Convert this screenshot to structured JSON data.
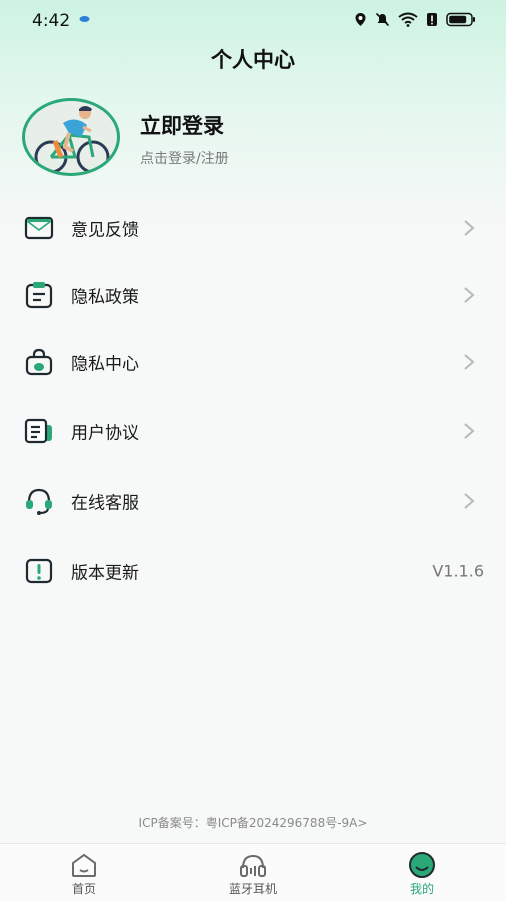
{
  "status_bar": {
    "time": "4:42"
  },
  "header": {
    "title": "个人中心"
  },
  "profile": {
    "login_title": "立即登录",
    "login_subtitle": "点击登录/注册"
  },
  "menu": {
    "items": [
      {
        "label": "意见反馈",
        "icon": "mail-icon"
      },
      {
        "label": "隐私政策",
        "icon": "clipboard-icon"
      },
      {
        "label": "隐私中心",
        "icon": "lock-bag-icon"
      },
      {
        "label": "用户协议",
        "icon": "document-icon"
      },
      {
        "label": "在线客服",
        "icon": "headset-icon"
      },
      {
        "label": "版本更新",
        "icon": "alert-icon",
        "value": "V1.1.6"
      }
    ]
  },
  "footer": {
    "icp": "ICP备案号：粤ICP备2024296788号-9A>"
  },
  "tabbar": {
    "tabs": [
      {
        "label": "首页",
        "icon": "home-icon"
      },
      {
        "label": "蓝牙耳机",
        "icon": "headphones-icon"
      },
      {
        "label": "我的",
        "icon": "smile-icon",
        "active": true
      }
    ]
  },
  "colors": {
    "accent": "#2aa878",
    "text": "#1a1a1a",
    "muted": "#7a7a7a"
  }
}
